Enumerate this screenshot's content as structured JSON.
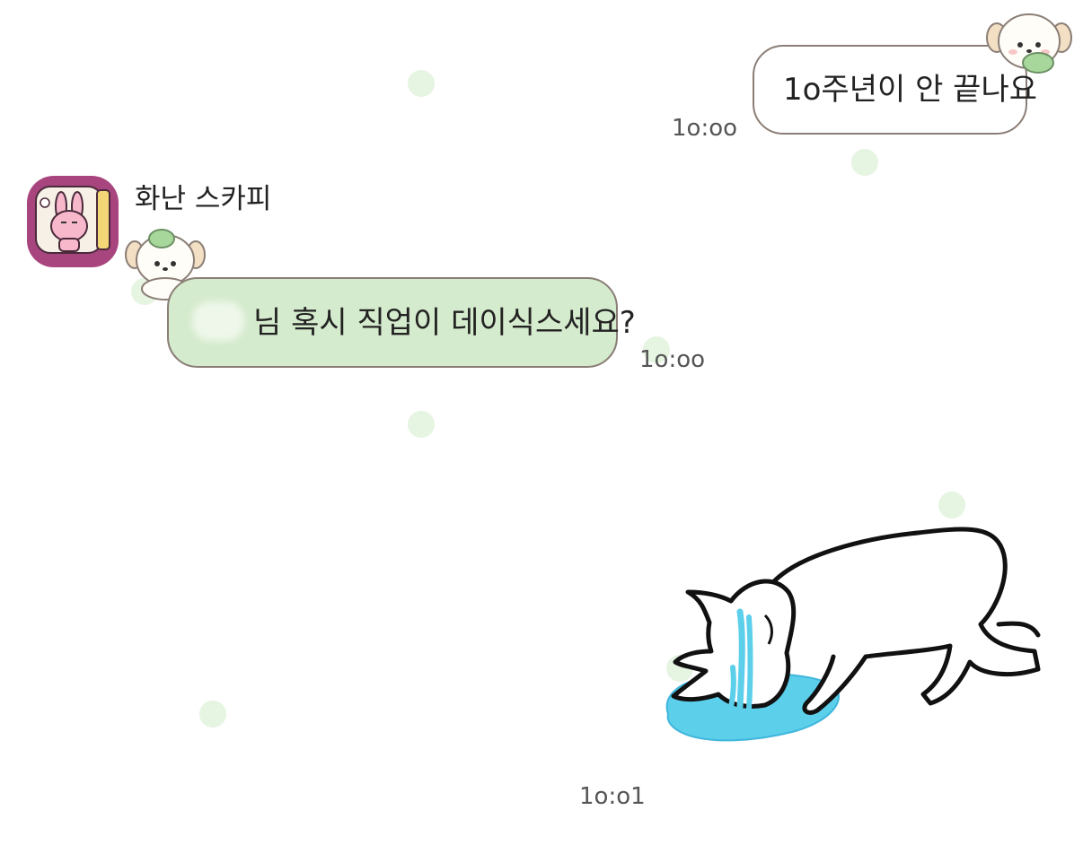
{
  "chat": {
    "messages": [
      {
        "from": "me",
        "text": "1o주년이 안 끝나요",
        "time": "1o:oo"
      },
      {
        "from": "other",
        "sender": "화난 스카피",
        "text": "님 혹시 직업이 데이식스세요?",
        "time": "1o:oo"
      },
      {
        "from": "other",
        "type": "sticker",
        "sticker": "crying-cat-sticker",
        "time": "1o:o1"
      }
    ]
  },
  "colors": {
    "background": "#ffffff",
    "bubble_other": "#d5ebcd",
    "bubble_me": "#ffffff",
    "bubble_border": "#8a7e76",
    "avatar_bg": "#a8457e",
    "tear": "#5ccfea"
  },
  "icons": {
    "avatar": "rabbit-avatar-icon",
    "deco_me": "puppy-leaf-icon",
    "deco_other": "puppy-leaf-icon"
  }
}
